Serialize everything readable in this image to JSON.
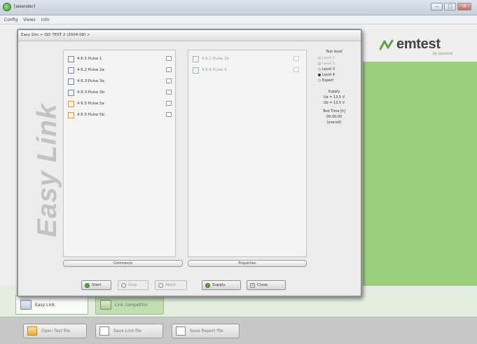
{
  "app": {
    "title": "[wsender]",
    "controls": [
      "‒",
      "□",
      "✕"
    ],
    "menu": [
      "Config",
      "Views",
      "Info"
    ]
  },
  "brand": {
    "name": "emtest",
    "tagline": "by Lamond"
  },
  "dialog": {
    "title": "Easy Sim > ISO TEST 2 (2004-08) >",
    "side_title": "Easy Link",
    "left_list": [
      {
        "label": "4.6.1 Pulse 1",
        "icon": "pulse-icon"
      },
      {
        "label": "4.6.2 Pulse 2a",
        "icon": "pulse-icon"
      },
      {
        "label": "4.6.3 Pulse 3a",
        "icon": "pulse-icon"
      },
      {
        "label": "4.6.3 Pulse 3b",
        "icon": "pulse-icon"
      },
      {
        "label": "4.6.5 Pulse 5a",
        "icon": "pulse-icon-orange"
      },
      {
        "label": "4.6.5 Pulse 5b",
        "icon": "pulse-icon-orange"
      }
    ],
    "right_list": [
      {
        "label": "4.6.2 Pulse 2b",
        "icon": "pulse-icon"
      },
      {
        "label": "4.6.6 Pulse 4",
        "icon": "pulse-icon"
      }
    ],
    "comments_label": "Comments",
    "properties_label": "Properties",
    "test_level": {
      "title": "Test level",
      "levels": [
        {
          "label": "Level 1",
          "selected": false,
          "enabled": false
        },
        {
          "label": "Level 2",
          "selected": false,
          "enabled": false
        },
        {
          "label": "Level 3",
          "selected": false,
          "enabled": true
        },
        {
          "label": "Level 4",
          "selected": true,
          "enabled": true
        },
        {
          "label": "Expert",
          "selected": false,
          "enabled": true
        }
      ]
    },
    "supply": {
      "title": "Supply",
      "ua": "Ua = 13.5 V",
      "ub": "Ub = 13.5 V"
    },
    "test_time": {
      "title": "Test Time [h]",
      "value": "00:00:00",
      "note": "(overall)"
    },
    "buttons": {
      "start": "Start",
      "stop": "Stop",
      "abort": "Abort",
      "supply": "Supply",
      "close": "Close"
    }
  },
  "modes": {
    "active": "Easy Link",
    "other": "Link competitor"
  },
  "bottom": {
    "open": "Open Test file",
    "save": "Save Link file",
    "report": "Save Report file"
  },
  "colors": {
    "brand_green": "#9ccf80",
    "easy_link_text": "#c2c2c2"
  }
}
